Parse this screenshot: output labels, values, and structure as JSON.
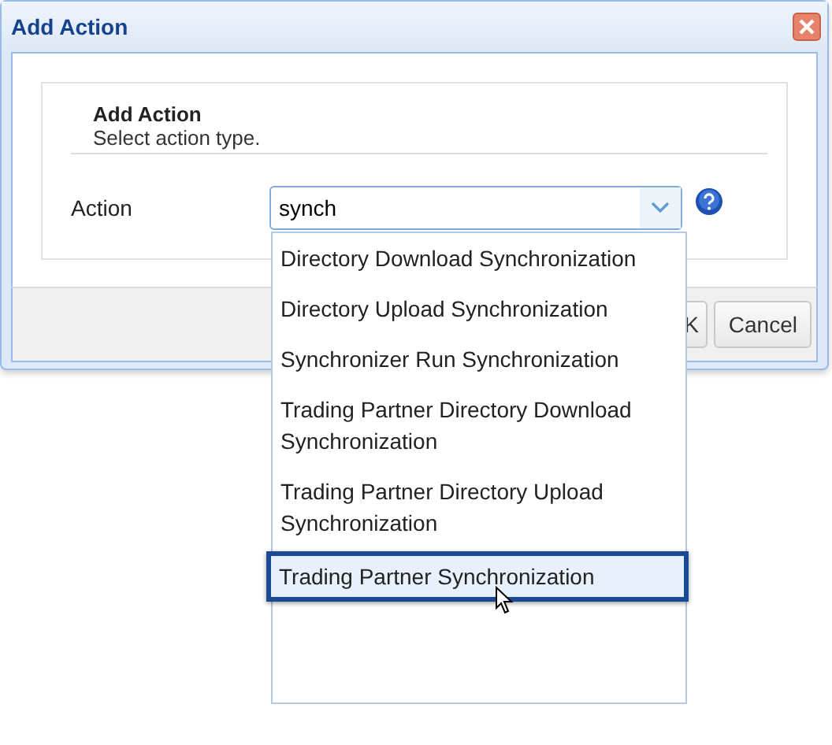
{
  "window": {
    "title": "Add Action"
  },
  "panel": {
    "heading": "Add Action",
    "subtitle": "Select action type."
  },
  "field": {
    "label": "Action",
    "value": "synch",
    "expanded": true
  },
  "dropdown": {
    "options": [
      {
        "label": "Directory Download Synchronization",
        "selected": false
      },
      {
        "label": "Directory Upload Synchronization",
        "selected": false
      },
      {
        "label": "Synchronizer Run Synchronization",
        "selected": false
      },
      {
        "label": "Trading Partner Directory Download Synchronization",
        "selected": false
      },
      {
        "label": "Trading Partner Directory Upload Synchronization",
        "selected": false
      },
      {
        "label": "Trading Partner Synchronization",
        "selected": true
      }
    ]
  },
  "buttons": [
    "K",
    "Cancel"
  ]
}
